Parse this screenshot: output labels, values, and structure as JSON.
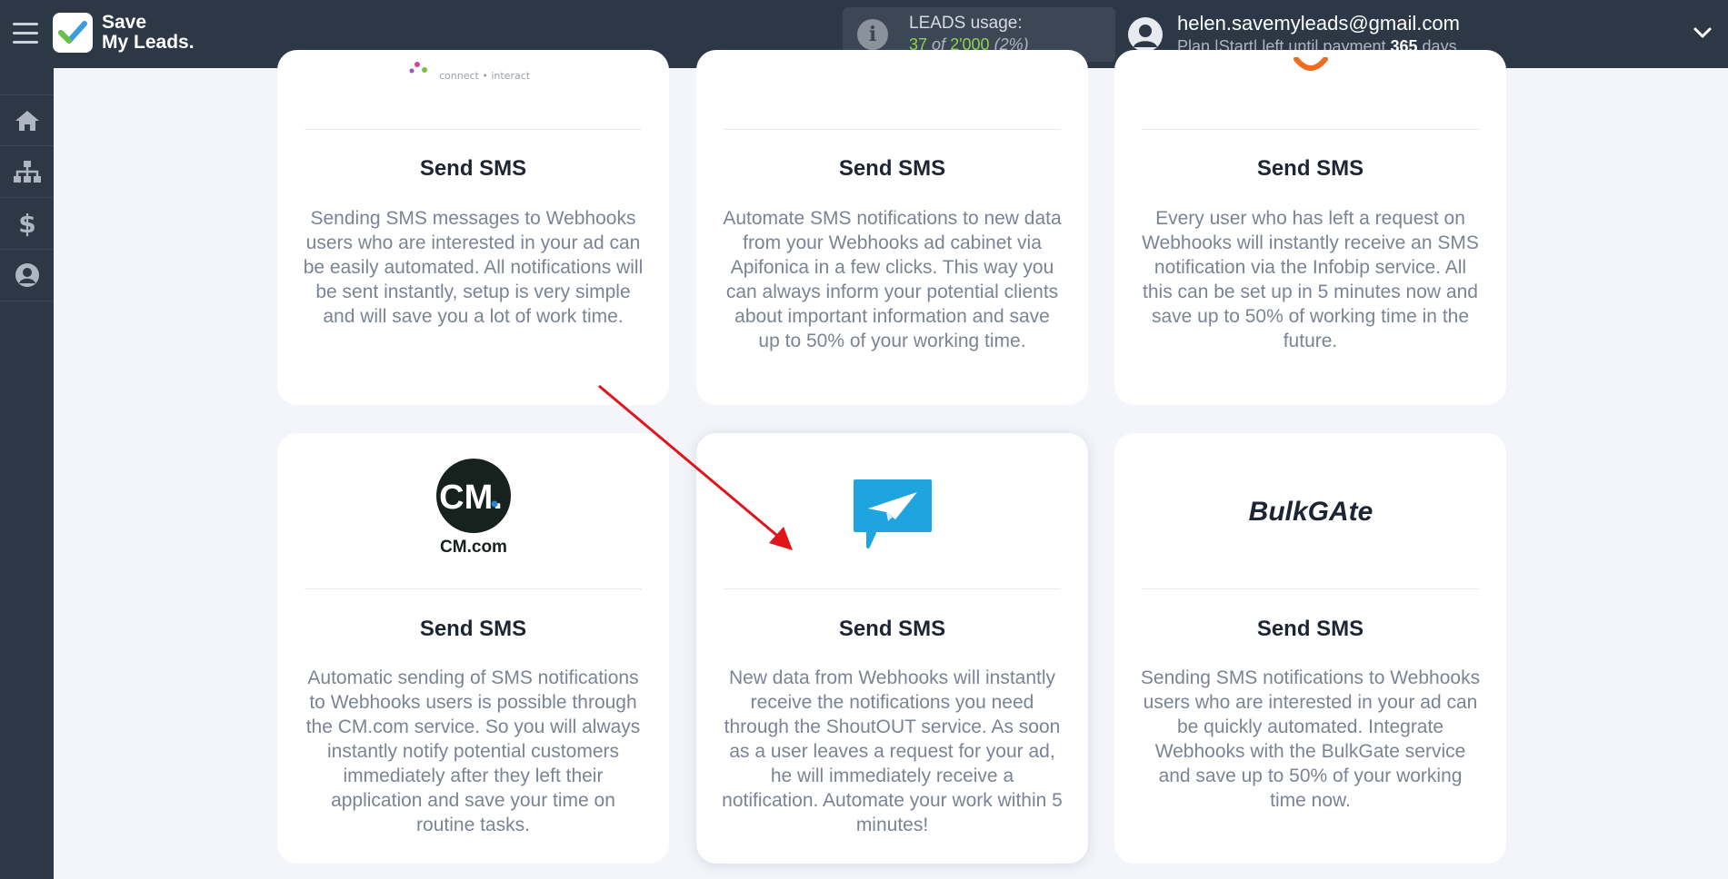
{
  "app": {
    "brand_line1": "Save",
    "brand_line2": "My Leads."
  },
  "leads": {
    "title": "LEADS usage:",
    "used": "37",
    "of_label": "of",
    "total": "2'000",
    "percent": "(2%)"
  },
  "user": {
    "email": "helen.savemyleads@gmail.com",
    "plan_prefix": "Plan |Start| left until payment",
    "days": "365",
    "days_suffix": "days"
  },
  "sidebar": {
    "items": [
      {
        "icon": "home-icon"
      },
      {
        "icon": "sitemap-icon"
      },
      {
        "icon": "dollar-icon"
      },
      {
        "icon": "user-circle-icon"
      }
    ]
  },
  "cards": [
    {
      "title": "Send SMS",
      "logo_text": "connect • interact",
      "desc": "Sending SMS messages to Webhooks users who are interested in your ad can be easily automated. All notifications will be sent instantly, setup is very simple and will save you a lot of work time."
    },
    {
      "title": "Send SMS",
      "desc": "Automate SMS notifications to new data from your Webhooks ad cabinet via Apifonica in a few clicks. This way you can always inform your potential clients about important information and save up to 50% of your working time."
    },
    {
      "title": "Send SMS",
      "desc": "Every user who has left a request on Webhooks will instantly receive an SMS notification via the Infobip service. All this can be set up in 5 minutes now and save up to 50% of working time in the future."
    },
    {
      "title": "Send SMS",
      "logo_text": "CM.",
      "logo_sub": "CM.com",
      "desc": "Automatic sending of SMS notifications to Webhooks users is possible through the CM.com service. So you will always instantly notify potential customers immediately after they left their application and save your time on routine tasks."
    },
    {
      "title": "Send SMS",
      "desc": "New data from Webhooks will instantly receive the notifications you need through the ShoutOUT service. As soon as a user leaves a request for your ad, he will immediately receive a notification. Automate your work within 5 minutes!"
    },
    {
      "title": "Send SMS",
      "logo_text": "BulkGAte",
      "desc": "Sending SMS notifications to Webhooks users who are interested in your ad can be quickly automated. Integrate Webhooks with the BulkGate service and save up to 50% of your working time now."
    }
  ],
  "colors": {
    "topbar": "#2d3846",
    "accent_green": "#8fd14f",
    "arrow_red": "#e0141b",
    "shoutout_blue": "#1ea5e0"
  }
}
